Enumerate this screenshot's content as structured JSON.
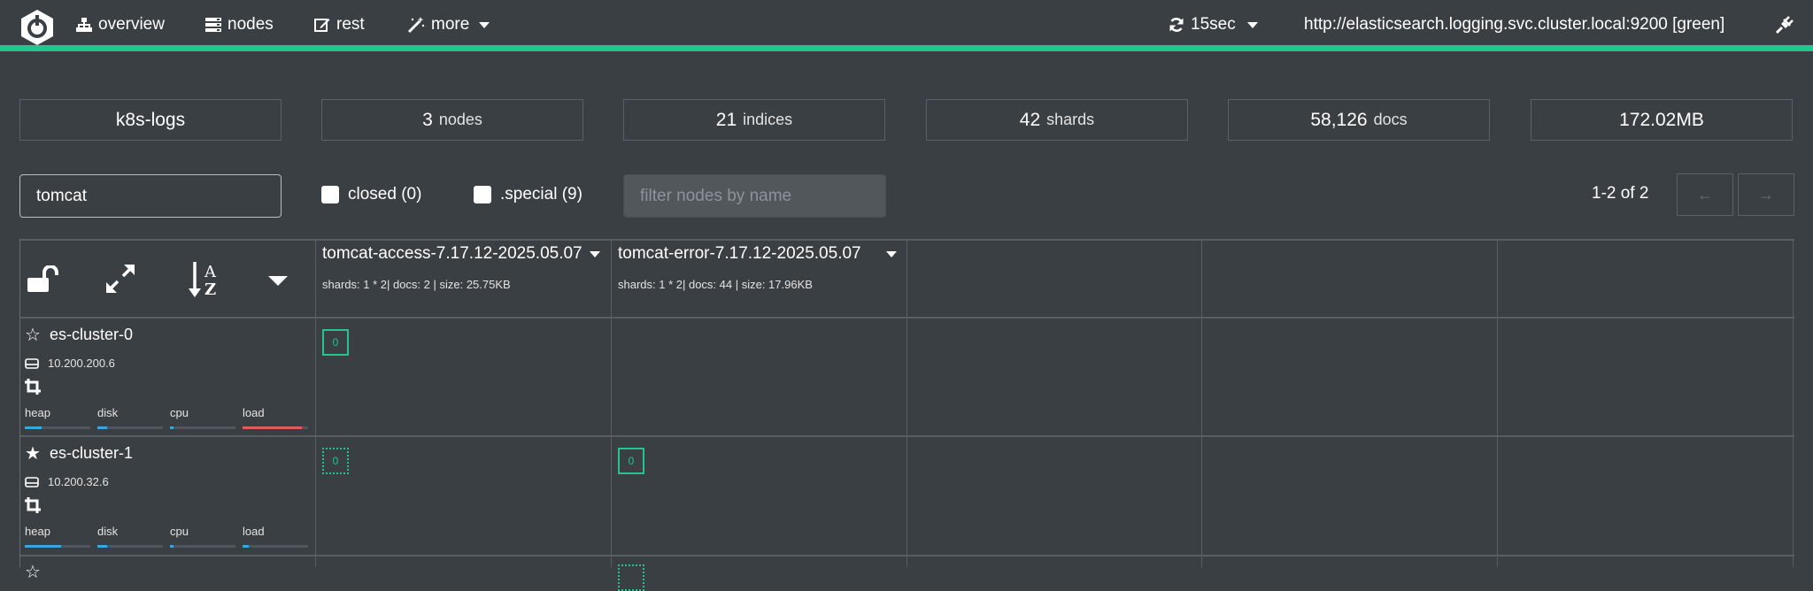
{
  "navbar": {
    "nav_items": [
      {
        "label": "overview",
        "icon": "sitemap-icon"
      },
      {
        "label": "nodes",
        "icon": "server-icon"
      },
      {
        "label": "rest",
        "icon": "edit-icon"
      },
      {
        "label": "more",
        "icon": "magic-wand-icon"
      }
    ],
    "refresh": {
      "label": "15sec",
      "icon": "refresh-icon"
    },
    "connection": "http://elasticsearch.logging.svc.cluster.local:9200 [green]",
    "accent_color": "#23c48e"
  },
  "stats": [
    {
      "value": "k8s-logs",
      "unit": ""
    },
    {
      "value": "3",
      "unit": "nodes"
    },
    {
      "value": "21",
      "unit": "indices"
    },
    {
      "value": "42",
      "unit": "shards"
    },
    {
      "value": "58,126",
      "unit": "docs"
    },
    {
      "value": "172.02MB",
      "unit": ""
    }
  ],
  "filters": {
    "index_filter_value": "tomcat",
    "closed_label": "closed (0)",
    "special_label": ".special (9)",
    "node_filter_placeholder": "filter nodes by name",
    "pagination": "1-2 of 2"
  },
  "indices": [
    {
      "name": "tomcat-access-7.17.12-2025.05.07",
      "meta": "shards: 1 * 2| docs: 2 | size: 25.75KB"
    },
    {
      "name": "tomcat-error-7.17.12-2025.05.07",
      "meta": "shards: 1 * 2| docs: 44 | size: 17.96KB"
    }
  ],
  "nodes": [
    {
      "name": "es-cluster-0",
      "ip": "10.200.200.6",
      "master": false,
      "metrics": [
        {
          "label": "heap",
          "fraction": 0.25,
          "color": "#3aa6e0"
        },
        {
          "label": "disk",
          "fraction": 0.15,
          "color": "#3aa6e0"
        },
        {
          "label": "cpu",
          "fraction": 0.05,
          "color": "#3aa6e0"
        },
        {
          "label": "load",
          "fraction": 0.9,
          "color": "#e05a62"
        }
      ],
      "shards": [
        {
          "index": 0,
          "number": "0",
          "type": "primary"
        }
      ]
    },
    {
      "name": "es-cluster-1",
      "ip": "10.200.32.6",
      "master": true,
      "metrics": [
        {
          "label": "heap",
          "fraction": 0.55,
          "color": "#3aa6e0"
        },
        {
          "label": "disk",
          "fraction": 0.15,
          "color": "#3aa6e0"
        },
        {
          "label": "cpu",
          "fraction": 0.05,
          "color": "#3aa6e0"
        },
        {
          "label": "load",
          "fraction": 0.1,
          "color": "#3aa6e0"
        }
      ],
      "shards": [
        {
          "index": 0,
          "number": "0",
          "type": "replica"
        },
        {
          "index": 1,
          "number": "0",
          "type": "primary"
        }
      ]
    }
  ]
}
